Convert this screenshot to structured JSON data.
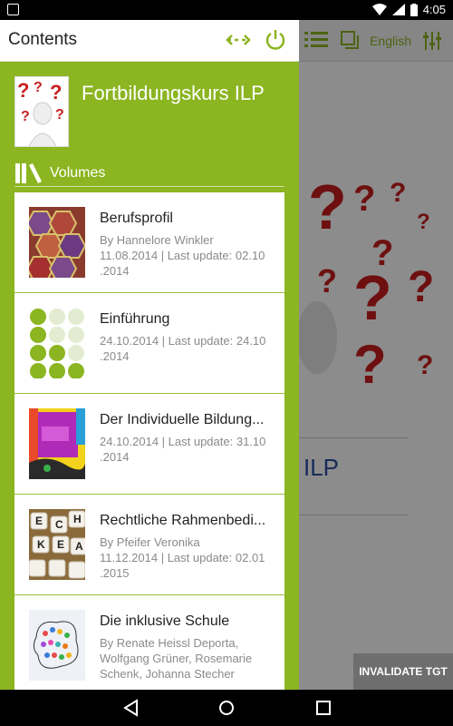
{
  "status_bar": {
    "time": "4:05"
  },
  "background": {
    "language_label": "English",
    "heading_fragment": "ILP",
    "invalidate_button": "INVALIDATE TGT"
  },
  "drawer": {
    "title": "Contents",
    "course_title": "Fortbildungskurs ILP",
    "volumes_label": "Volumes",
    "volumes": [
      {
        "title": "Berufsprofil",
        "author": "By Hannelore Winkler",
        "dates": "11.08.2014 | Last update: 02.10\n.2014"
      },
      {
        "title": "Einführung",
        "author": "",
        "dates": "24.10.2014 | Last update: 24.10\n.2014"
      },
      {
        "title": "Der Individuelle Bildung...",
        "author": "",
        "dates": "24.10.2014 | Last update: 31.10\n.2014"
      },
      {
        "title": "Rechtliche Rahmenbedi...",
        "author": "By Pfeifer Veronika",
        "dates": "11.12.2014 | Last update: 02.01\n.2015"
      },
      {
        "title": "Die inklusive Schule",
        "author": "By Renate Heissl Deporta,\n    Wolfgang Grüner, Rosemarie\n    Schenk, Johanna Stecher",
        "dates": ""
      }
    ]
  },
  "colors": {
    "accent": "#8bb521",
    "bg_title": "#2b4fa0"
  }
}
